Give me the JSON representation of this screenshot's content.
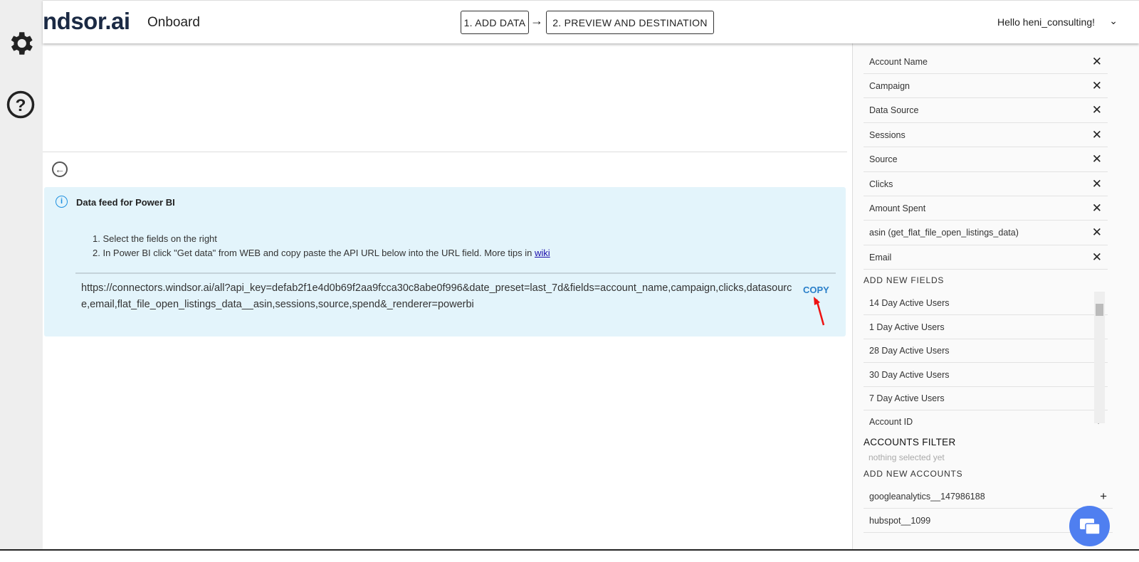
{
  "header": {
    "logo": "ndsor.ai",
    "app": "Onboard",
    "step1": "1. ADD DATA",
    "arrow": "→",
    "step2": "2. PREVIEW AND DESTINATION",
    "greeting": "Hello heni_consulting!"
  },
  "info": {
    "title": "Data feed for Power BI",
    "step1": "1. Select the fields on the right",
    "step2": "2. In Power BI click \"Get data\" from WEB and copy paste the API URL below into the URL field. More tips in ",
    "wiki": "wiki",
    "url": "https://connectors.windsor.ai/all?api_key=defab2f1e4d0b69f2aa9fcca30c8abe0f996&date_preset=last_7d&fields=account_name,campaign,clicks,datasource,email,flat_file_open_listings_data__asin,sessions,source,spend&_renderer=powerbi",
    "copy": "COPY"
  },
  "panel": {
    "selected_fields": [
      "Account Name",
      "Campaign",
      "Data Source",
      "Sessions",
      "Source",
      "Clicks",
      "Amount Spent",
      "asin (get_flat_file_open_listings_data)",
      "Email"
    ],
    "add_fields_label": "ADD NEW FIELDS",
    "new_fields": [
      "14 Day Active Users",
      "1 Day Active Users",
      "28 Day Active Users",
      "30 Day Active Users",
      "7 Day Active Users",
      "Account ID"
    ],
    "accounts_filter": "ACCOUNTS FILTER",
    "nothing_selected": "nothing selected yet",
    "add_accounts_label": "ADD NEW ACCOUNTS",
    "accounts": [
      "googleanalytics__147986188",
      "hubspot__1099"
    ]
  },
  "icons": {
    "remove": "✕",
    "add": "+"
  }
}
